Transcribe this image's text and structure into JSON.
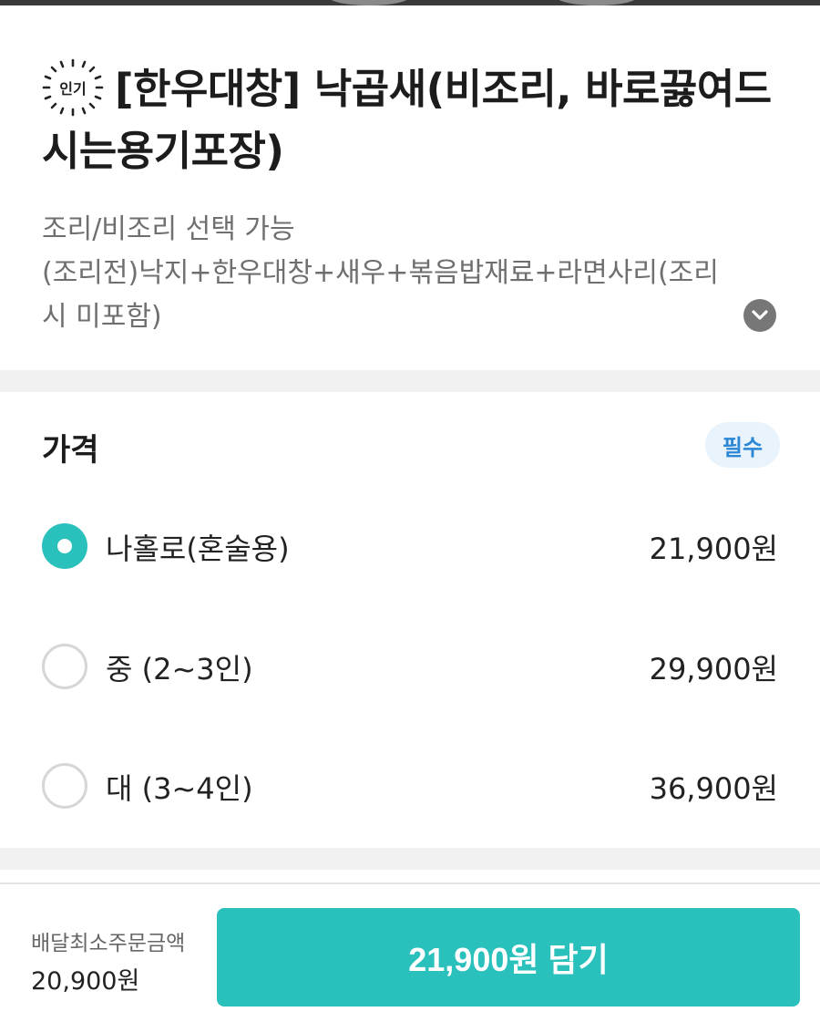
{
  "colors": {
    "accent": "#2ac1bc",
    "required_badge_bg": "#e9f3fb",
    "required_badge_text": "#2b86d6",
    "description_text": "#6f6f6f"
  },
  "menu": {
    "badge_text": "인기",
    "title": "[한우대창] 낙곱새(비조리, 바로끓여드시는용기포장)",
    "description_lines": [
      "조리/비조리 선택 가능",
      "(조리전)낙지+한우대창+새우+볶음밥재료+라면사리(조리",
      "시 미포함)"
    ],
    "expand_icon": "chevron-down-icon"
  },
  "price_section": {
    "heading": "가격",
    "required_label": "필수",
    "options": [
      {
        "label": "나홀로(혼술용)",
        "price": "21,900원",
        "selected": true
      },
      {
        "label": "중 (2~3인)",
        "price": "29,900원",
        "selected": false
      },
      {
        "label": "대 (3~4인)",
        "price": "36,900원",
        "selected": false
      }
    ]
  },
  "bottom_bar": {
    "min_order_label": "배달최소주문금액",
    "min_order_value": "20,900원",
    "add_button_label": "21,900원 담기"
  }
}
